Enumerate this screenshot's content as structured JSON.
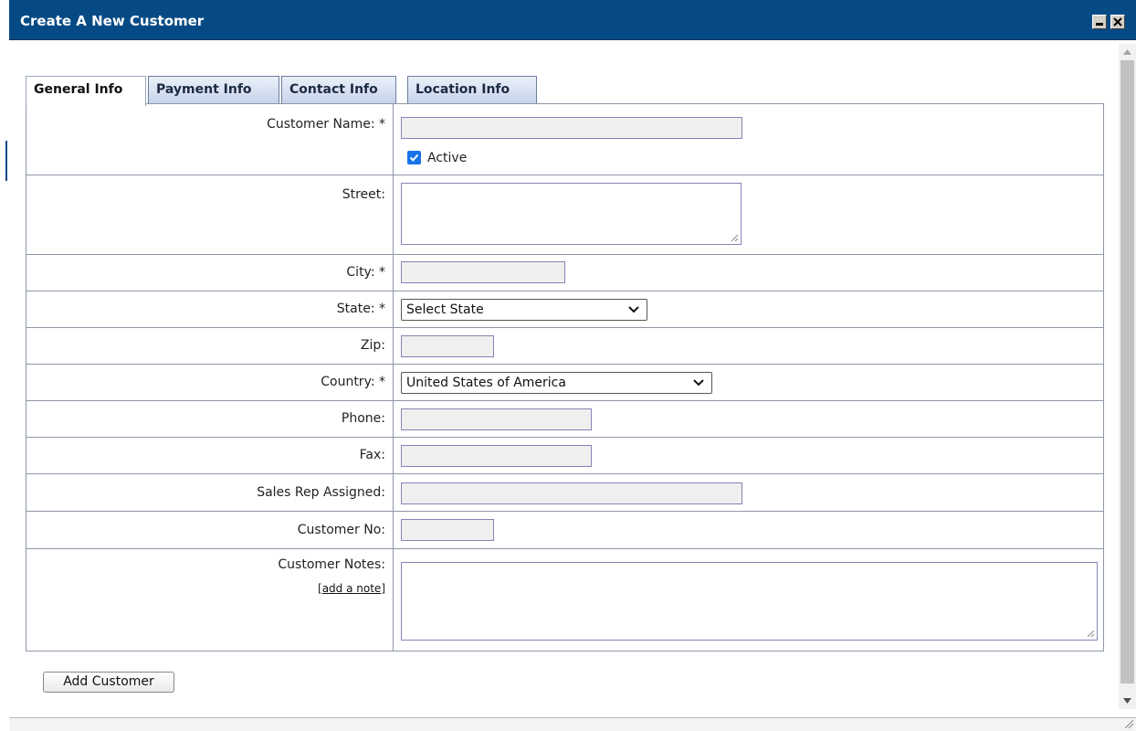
{
  "window": {
    "title": "Create A New Customer",
    "minimize_icon": "minimize-icon",
    "close_icon": "close-icon"
  },
  "tabs": [
    {
      "label": "General Info",
      "active": true
    },
    {
      "label": "Payment Info",
      "active": false
    },
    {
      "label": "Contact Info",
      "active": false
    },
    {
      "label": "Location Info",
      "active": false
    }
  ],
  "form": {
    "customer_name": {
      "label": "Customer Name: *",
      "value": ""
    },
    "active": {
      "label": "Active",
      "checked": true
    },
    "street": {
      "label": "Street:",
      "value": ""
    },
    "city": {
      "label": "City: *",
      "value": ""
    },
    "state": {
      "label": "State: *",
      "selected": "Select State"
    },
    "zip": {
      "label": "Zip:",
      "value": ""
    },
    "country": {
      "label": "Country: *",
      "selected": "United States of America"
    },
    "phone": {
      "label": "Phone:",
      "value": ""
    },
    "fax": {
      "label": "Fax:",
      "value": ""
    },
    "sales_rep": {
      "label": "Sales Rep Assigned:",
      "value": ""
    },
    "customer_no": {
      "label": "Customer No:",
      "value": ""
    },
    "customer_notes": {
      "label": "Customer Notes:",
      "link_open": "[",
      "link_text": "add a note",
      "link_close": "]",
      "value": ""
    }
  },
  "actions": {
    "add_customer": "Add Customer"
  },
  "colors": {
    "titlebar": "#054a85",
    "tab_gradient_top": "#eaf0f9",
    "tab_gradient_bottom": "#c5d3ea",
    "input_fill": "#efefef",
    "checkbox": "#1a73e8"
  }
}
